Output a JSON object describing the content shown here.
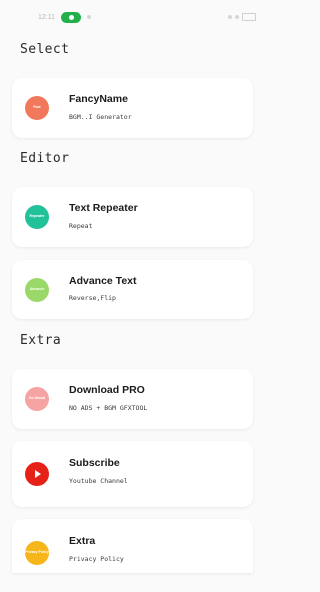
{
  "status_bar": {
    "time": "12:11",
    "indicators": [
      "dot",
      "dot",
      "battery"
    ]
  },
  "sections": [
    {
      "title": "Select",
      "items": [
        {
          "title": "FancyName",
          "subtitle": "BGM..I Generator",
          "icon": "fancyname-logo-icon",
          "icon_text": "Fast",
          "color": "#f2785c"
        }
      ]
    },
    {
      "title": "Editor",
      "items": [
        {
          "title": "Text Repeater",
          "subtitle": "Repeat",
          "icon": "text-repeater-logo-icon",
          "icon_text": "Repeater",
          "color": "#21c29a"
        },
        {
          "title": "Advance Text",
          "subtitle": "Reverse,Flip",
          "icon": "advance-text-logo-icon",
          "icon_text": "Advance",
          "color": "#9bd86a"
        }
      ]
    },
    {
      "title": "Extra",
      "items": [
        {
          "title": "Download PRO",
          "subtitle": "NO ADS + BGM GFXTOOL",
          "icon": "download-pro-logo-icon",
          "icon_text": "Go Ahead",
          "color": "#f5a3a3"
        },
        {
          "title": "Subscribe",
          "subtitle": "Youtube Channel",
          "icon": "youtube-play-icon",
          "icon_text": "",
          "color": "#e62117"
        },
        {
          "title": "Extra",
          "subtitle": "Privacy Policy",
          "icon": "privacy-policy-logo-icon",
          "icon_text": "Privacy Policy",
          "color": "#f6b619"
        }
      ]
    }
  ]
}
